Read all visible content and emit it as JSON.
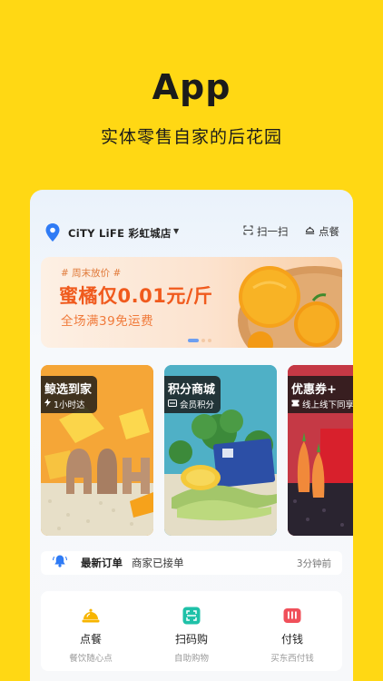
{
  "hero": {
    "title": "App",
    "subtitle": "实体零售自家的后花园"
  },
  "header": {
    "store_name": "CiTY LiFE 彩虹城店",
    "caret": "▼",
    "scan_label": "扫一扫",
    "order_label": "点餐"
  },
  "banner": {
    "tag": "# 周末放价 #",
    "title": "蜜橘仅0.01元/斤",
    "subtitle": "全场满39免运费",
    "active_slide": 1,
    "slide_count": 3
  },
  "cards": [
    {
      "title": "鲸选到家",
      "subtitle": "1小时达",
      "icon": "lightning-icon"
    },
    {
      "title": "积分商城",
      "subtitle": "会员积分",
      "icon": "points-icon"
    },
    {
      "title": "优惠券+",
      "subtitle": "线上线下同享",
      "icon": "ticket-icon"
    }
  ],
  "notice": {
    "label": "最新订单",
    "message": "商家已接单",
    "time": "3分钟前",
    "icon": "bell-icon"
  },
  "actions": [
    {
      "label": "点餐",
      "sub": "餐饮随心点",
      "icon": "dining-bell-icon",
      "color": "#F7B500"
    },
    {
      "label": "扫码购",
      "sub": "自助购物",
      "icon": "scan-icon",
      "color": "#1FC1A8"
    },
    {
      "label": "付钱",
      "sub": "买东西付钱",
      "icon": "pay-icon",
      "color": "#F0505A"
    }
  ],
  "colors": {
    "background": "#FFD814",
    "accent_orange": "#F05A1D",
    "brand_blue": "#2F7BF5"
  }
}
